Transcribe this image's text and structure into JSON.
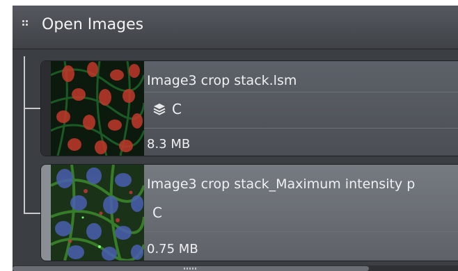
{
  "panel": {
    "title": "Open Images"
  },
  "images": [
    {
      "name": "Image3 crop stack.lsm",
      "channel": "C",
      "size": "8.3 MB",
      "stack_icon": "layers-icon"
    },
    {
      "name": "Image3 crop stack_Maximum intensity p",
      "channel": "C",
      "size": "0.75 MB"
    }
  ],
  "colors": {
    "panel_bg": "#3a3d42",
    "header": "#4b4f55",
    "selected_item": "#6a6e74",
    "text": "#eef0f2"
  }
}
